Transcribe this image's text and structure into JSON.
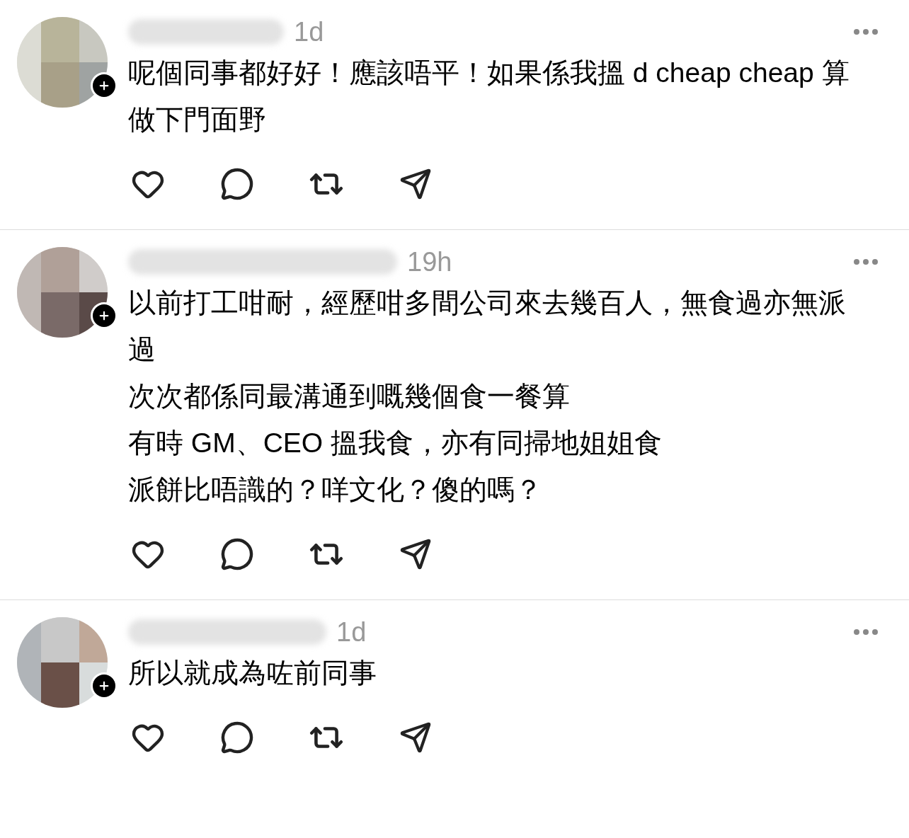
{
  "posts": [
    {
      "time": "1d",
      "text": [
        "呢個同事都好好！應該唔平！如果係我搵 d cheap cheap 算做下門面野"
      ]
    },
    {
      "time": "19h",
      "text": [
        "以前打工咁耐，經歷咁多間公司來去幾百人，無食過亦無派過",
        "次次都係同最溝通到嘅幾個食一餐算",
        "有時 GM、CEO 搵我食，亦有同掃地姐姐食",
        "派餅比唔識的？咩文化？傻的嗎？"
      ]
    },
    {
      "time": "1d",
      "text": [
        "所以就成為咗前同事"
      ]
    }
  ]
}
